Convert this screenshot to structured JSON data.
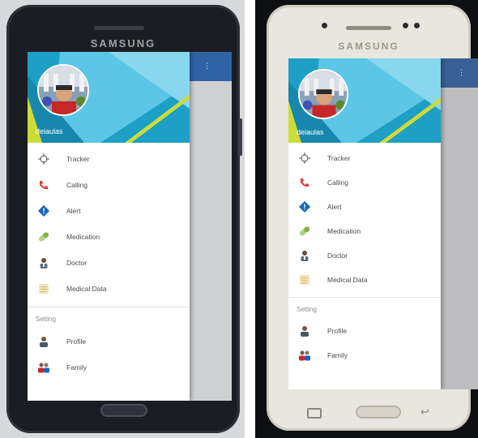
{
  "left_photo": {
    "brand": "SAMSUNG",
    "app": {
      "username": "deiaulas",
      "menu": [
        {
          "icon": "crosshair-icon",
          "label": "Tracker"
        },
        {
          "icon": "phone-icon",
          "label": "Calling"
        },
        {
          "icon": "alert-diamond-icon",
          "label": "Alert"
        },
        {
          "icon": "pill-icon",
          "label": "Medication"
        },
        {
          "icon": "doctor-icon",
          "label": "Doctor"
        },
        {
          "icon": "medical-data-icon",
          "label": "Medical Data"
        }
      ],
      "settings_header": "Setting",
      "settings": [
        {
          "icon": "profile-icon",
          "label": "Profile"
        },
        {
          "icon": "family-icon",
          "label": "Family"
        }
      ]
    }
  },
  "right_photo": {
    "brand": "SAMSUNG",
    "app": {
      "username": "deiaulas",
      "menu": [
        {
          "icon": "crosshair-icon",
          "label": "Tracker"
        },
        {
          "icon": "phone-icon",
          "label": "Calling"
        },
        {
          "icon": "alert-diamond-icon",
          "label": "Alert"
        },
        {
          "icon": "pill-icon",
          "label": "Medication"
        },
        {
          "icon": "doctor-icon",
          "label": "Doctor"
        },
        {
          "icon": "medical-data-icon",
          "label": "Medical Data"
        }
      ],
      "settings_header": "Setting",
      "settings": [
        {
          "icon": "profile-icon",
          "label": "Profile"
        },
        {
          "icon": "family-icon",
          "label": "Family"
        }
      ]
    }
  },
  "colors": {
    "header_blue": "#1d9fc6",
    "header_accent_yellow": "#cddc39",
    "app_bar_blue": "#2f63a8",
    "phone_red_icon": "#e53935",
    "alert_blue_icon": "#1565c0",
    "pill_green_icon": "#7cb342"
  }
}
